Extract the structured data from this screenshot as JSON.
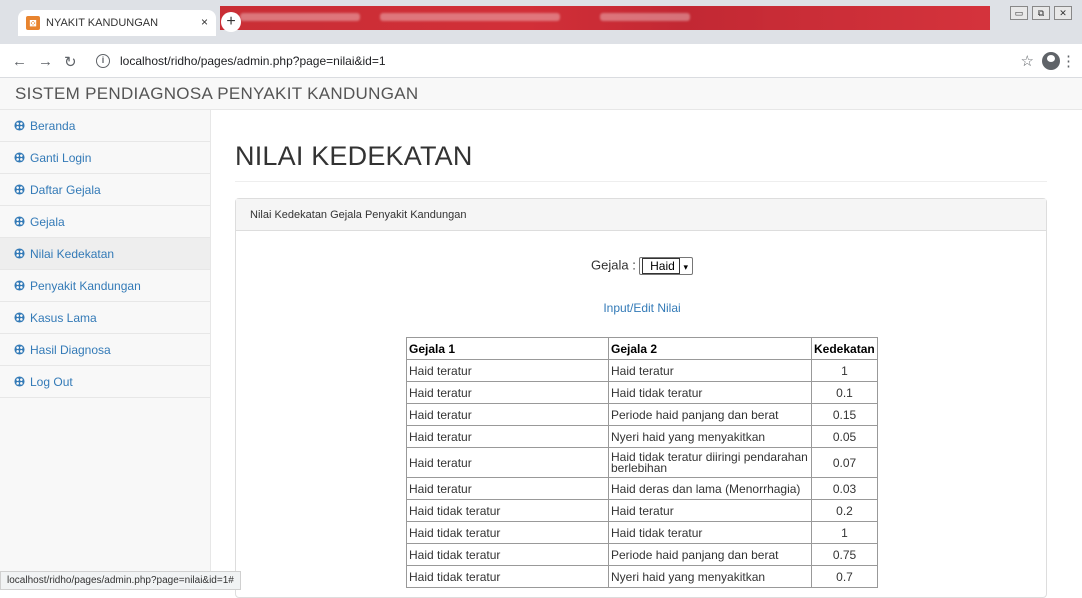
{
  "browser": {
    "tab_title": "NYAKIT KANDUNGAN",
    "tab_close": "×",
    "new_tab": "+",
    "url": "localhost/ridho/pages/admin.php?page=nilai&id=1",
    "status_url": "localhost/ridho/pages/admin.php?page=nilai&id=1#"
  },
  "app": {
    "brand": "SISTEM PENDIAGNOSA PENYAKIT KANDUNGAN"
  },
  "sidebar": {
    "items": [
      {
        "label": "Beranda"
      },
      {
        "label": "Ganti Login"
      },
      {
        "label": "Daftar Gejala"
      },
      {
        "label": "Gejala"
      },
      {
        "label": "Nilai Kedekatan"
      },
      {
        "label": "Penyakit Kandungan"
      },
      {
        "label": "Kasus Lama"
      },
      {
        "label": "Hasil Diagnosa"
      },
      {
        "label": "Log Out"
      }
    ],
    "active_index": 4
  },
  "main": {
    "title": "NILAI KEDEKATAN",
    "panel_heading": "Nilai Kedekatan Gejala Penyakit Kandungan",
    "gejala_label": "Gejala :",
    "gejala_selected": "Haid",
    "edit_link": "Input/Edit Nilai",
    "table": {
      "headers": [
        "Gejala 1",
        "Gejala 2",
        "Kedekatan"
      ],
      "rows": [
        [
          "Haid teratur",
          "Haid teratur",
          "1"
        ],
        [
          "Haid teratur",
          "Haid tidak teratur",
          "0.1"
        ],
        [
          "Haid teratur",
          "Periode haid panjang dan berat",
          "0.15"
        ],
        [
          "Haid teratur",
          "Nyeri haid yang menyakitkan",
          "0.05"
        ],
        [
          "Haid teratur",
          "Haid tidak teratur diiringi pendarahan berlebihan",
          "0.07"
        ],
        [
          "Haid teratur",
          "Haid deras dan lama (Menorrhagia)",
          "0.03"
        ],
        [
          "Haid tidak teratur",
          "Haid teratur",
          "0.2"
        ],
        [
          "Haid tidak teratur",
          "Haid tidak teratur",
          "1"
        ],
        [
          "Haid tidak teratur",
          "Periode haid panjang dan berat",
          "0.75"
        ],
        [
          "Haid tidak teratur",
          "Nyeri haid yang menyakitkan",
          "0.7"
        ]
      ]
    }
  },
  "colors": {
    "link": "#337ab7",
    "sidebar_bg": "#f8f8f8",
    "active_bg": "#eeeeee"
  }
}
